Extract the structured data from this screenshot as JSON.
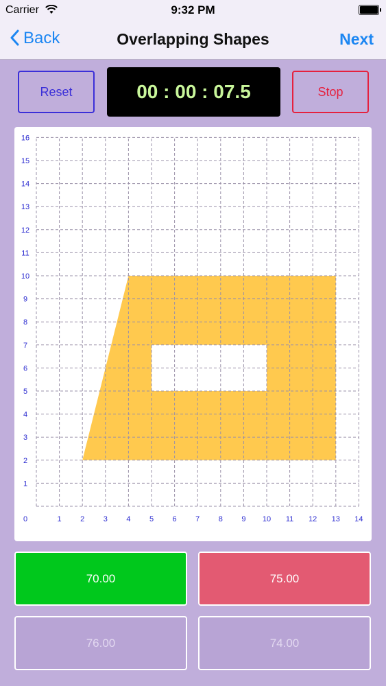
{
  "status_bar": {
    "carrier": "Carrier",
    "time": "9:32 PM"
  },
  "nav": {
    "back_label": "Back",
    "title": "Overlapping Shapes",
    "next_label": "Next",
    "accent_color": "#1c86f2"
  },
  "controls": {
    "reset_label": "Reset",
    "timer": "00 : 00 : 07.5",
    "stop_label": "Stop"
  },
  "grid": {
    "x_ticks": [
      "0",
      "1",
      "2",
      "3",
      "4",
      "5",
      "6",
      "7",
      "8",
      "9",
      "10",
      "11",
      "12",
      "13",
      "14"
    ],
    "y_ticks": [
      "1",
      "2",
      "3",
      "4",
      "5",
      "6",
      "7",
      "8",
      "9",
      "10",
      "11",
      "12",
      "13",
      "14",
      "15",
      "16"
    ],
    "x_range": [
      0,
      14
    ],
    "y_range": [
      0,
      16
    ],
    "fill_color": "#ffc94e",
    "shape_outer": [
      [
        2,
        2
      ],
      [
        4,
        10
      ],
      [
        13,
        10
      ],
      [
        13,
        2
      ]
    ],
    "shape_hole": [
      [
        5,
        5
      ],
      [
        10,
        5
      ],
      [
        10,
        7
      ],
      [
        5,
        7
      ]
    ]
  },
  "answers": [
    {
      "label": "70.00",
      "color": "#00c81c"
    },
    {
      "label": "75.00",
      "color": "#e35a72"
    },
    {
      "label": "76.00",
      "color": "#b8a4d5"
    },
    {
      "label": "74.00",
      "color": "#b8a4d5"
    }
  ]
}
